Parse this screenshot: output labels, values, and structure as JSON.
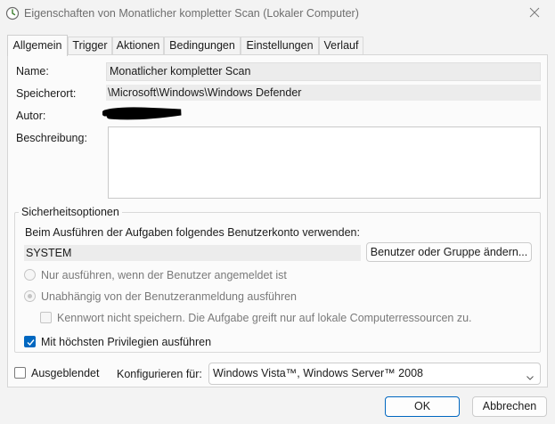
{
  "window": {
    "title": "Eigenschaften von Monatlicher kompletter Scan (Lokaler Computer)",
    "app_icon": "clock-icon",
    "close_icon": "close-icon"
  },
  "tabs": [
    {
      "label": "Allgemein",
      "active": true
    },
    {
      "label": "Trigger",
      "active": false
    },
    {
      "label": "Aktionen",
      "active": false
    },
    {
      "label": "Bedingungen",
      "active": false
    },
    {
      "label": "Einstellungen",
      "active": false
    },
    {
      "label": "Verlauf",
      "active": false
    }
  ],
  "general": {
    "name_label": "Name:",
    "name_value": "Monatlicher kompletter Scan",
    "location_label": "Speicherort:",
    "location_value": "\\Microsoft\\Windows\\Windows Defender",
    "author_label": "Autor:",
    "description_label": "Beschreibung:",
    "description_value": ""
  },
  "security": {
    "group_title": "Sicherheitsoptionen",
    "account_prompt": "Beim Ausführen der Aufgaben folgendes Benutzerkonto verwenden:",
    "account_value": "SYSTEM",
    "change_user_button": "Benutzer oder Gruppe ändern...",
    "radio_logged_on": "Nur ausführen, wenn der Benutzer angemeldet ist",
    "radio_any": "Unabhängig von der Benutzeranmeldung ausführen",
    "no_store_password": "Kennwort nicht speichern. Die Aufgabe greift nur auf lokale Computerressourcen zu.",
    "highest_privileges": "Mit höchsten Privilegien ausführen"
  },
  "footer": {
    "hidden_label": "Ausgeblendet",
    "configure_label": "Konfigurieren für:",
    "configure_value": "Windows Vista™, Windows Server™ 2008"
  },
  "buttons": {
    "ok": "OK",
    "cancel": "Abbrechen"
  },
  "colors": {
    "accent": "#0067c0",
    "redaction": "#000000"
  }
}
